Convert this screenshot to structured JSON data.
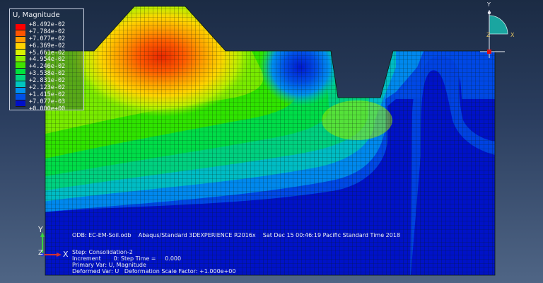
{
  "legend": {
    "title": "U, Magnitude",
    "values": [
      "+8.492e-02",
      "+7.784e-02",
      "+7.077e-02",
      "+6.369e-02",
      "+5.661e-02",
      "+4.954e-02",
      "+4.246e-02",
      "+3.538e-02",
      "+2.831e-02",
      "+2.123e-02",
      "+1.415e-02",
      "+7.077e-03",
      "+0.000e+00"
    ],
    "colors": [
      "#ff0000",
      "#ff5400",
      "#ff9c00",
      "#ffd400",
      "#d9f200",
      "#8ded00",
      "#3fe400",
      "#00e23c",
      "#00d47e",
      "#00c6c0",
      "#0090f0",
      "#0050e8",
      "#0010c8"
    ]
  },
  "triad_top": {
    "y": "Y",
    "z": "Z",
    "x": "X"
  },
  "info": {
    "odb_line": "ODB: EC-EM-Soil.odb    Abaqus/Standard 3DEXPERIENCE R2016x    Sat Dec 15 00:46:19 Pacific Standard Time 2018",
    "step": "Step: Consolidation-2",
    "increment": "Increment       0: Step Time =     0.000",
    "primary_var": "Primary Var: U, Magnitude",
    "deformed_var": "Deformed Var: U   Deformation Scale Factor: +1.000e+00"
  },
  "axes": {
    "y": "Y",
    "z": "Z",
    "x": "X"
  },
  "colors": {
    "mesh_line": "#0a1a0a",
    "background_top": "#1b2b44",
    "background_bottom": "#4f6585"
  }
}
